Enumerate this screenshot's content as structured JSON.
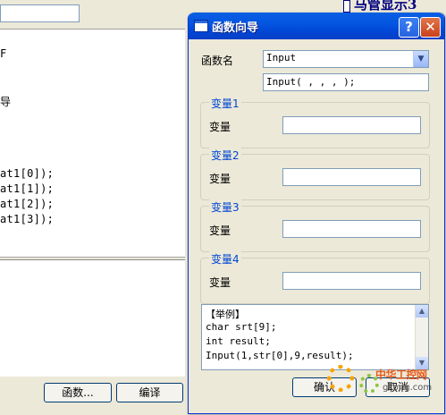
{
  "background_editor": {
    "fragment_top": "F",
    "fragment_mid": "导",
    "code_lines": [
      "at1[0]);",
      "at1[1]);",
      "at1[2]);",
      "at1[3]);"
    ],
    "buttons": {
      "function": "函数...",
      "compile": "编译"
    }
  },
  "background_right": {
    "title": "马管显示3"
  },
  "dialog": {
    "title": "函数向导",
    "help_glyph": "?",
    "close_glyph": "✕",
    "function_name_label": "函数名",
    "function_selected": "Input",
    "call_preview": "Input( , , , );",
    "groups": [
      {
        "title": "变量1",
        "label": "变量",
        "value": ""
      },
      {
        "title": "变量2",
        "label": "变量",
        "value": ""
      },
      {
        "title": "变量3",
        "label": "变量",
        "value": ""
      },
      {
        "title": "变量4",
        "label": "变量",
        "value": ""
      }
    ],
    "example_lines": [
      "【举例】",
      "char srt[9];",
      "int result;",
      "Input(1,str[0],9,result);"
    ],
    "ok_label": "确认",
    "cancel_label": "取消"
  },
  "watermark": {
    "text": "中华工控网",
    "url": "gkong.com"
  },
  "colors": {
    "titlebar": "#0454df",
    "group_title": "#0046d5",
    "close": "#c8421c"
  }
}
